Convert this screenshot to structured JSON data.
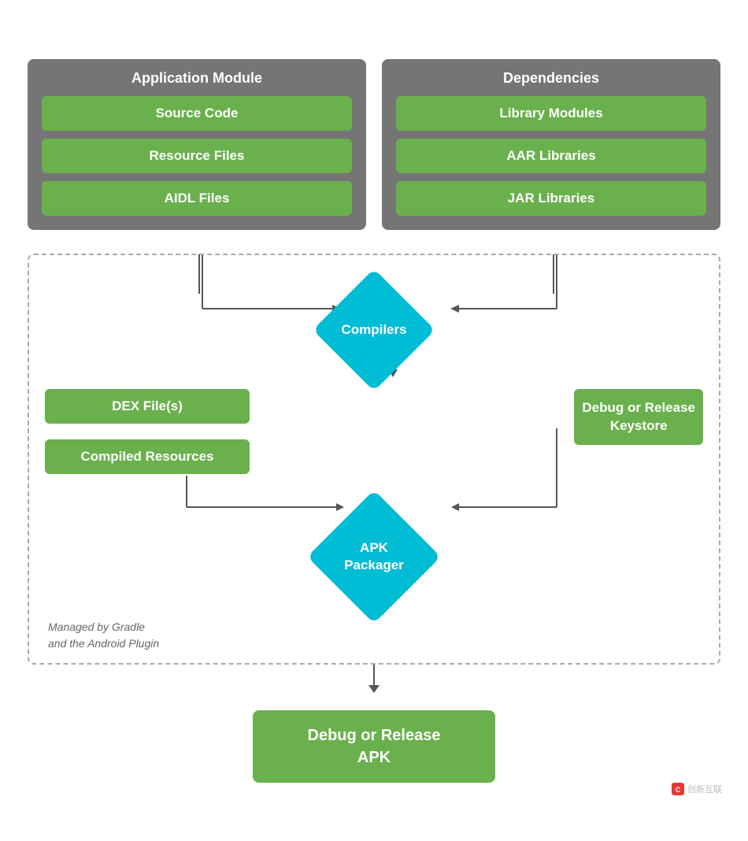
{
  "top": {
    "application_module": {
      "title": "Application Module",
      "items": [
        "Source Code",
        "Resource Files",
        "AIDL Files"
      ]
    },
    "dependencies": {
      "title": "Dependencies",
      "items": [
        "Library Modules",
        "AAR Libraries",
        "JAR Libraries"
      ]
    }
  },
  "compilers": {
    "label": "Compilers"
  },
  "middle": {
    "left": [
      "DEX File(s)",
      "Compiled Resources"
    ],
    "right": "Debug or Release\nKeystore"
  },
  "apk_packager": {
    "label": "APK\nPackager"
  },
  "gradle_note": {
    "line1": "Managed by Gradle",
    "line2": "and the Android Plugin"
  },
  "final_apk": {
    "label": "Debug or Release\nAPK"
  },
  "watermark": "创新互联"
}
